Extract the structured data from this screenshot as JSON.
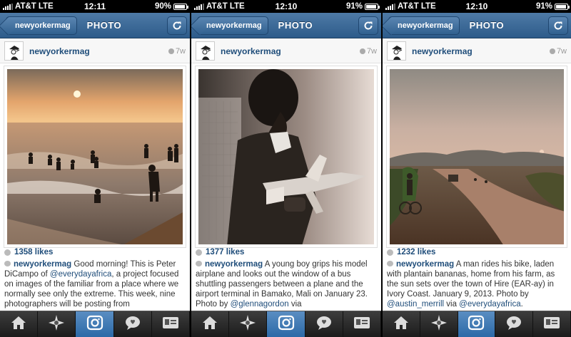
{
  "screens": [
    {
      "status": {
        "carrier": "AT&T",
        "network": "LTE",
        "time": "12:11",
        "battery": "90%",
        "battery_level": 0.9
      },
      "nav": {
        "back_label": "newyorkermag",
        "title": "PHOTO"
      },
      "post": {
        "username": "newyorkermag",
        "age": "7w",
        "likes": "1358 likes"
      },
      "caption": {
        "user": "newyorkermag",
        "parts": [
          {
            "t": "text",
            "v": " Good morning! This is Peter DiCampo of "
          },
          {
            "t": "mention",
            "v": "@everydayafrica"
          },
          {
            "t": "text",
            "v": ", a project focused on images of the familiar from a place where we normally see only the extreme. This week, nine photographers will be posting from"
          }
        ]
      }
    },
    {
      "status": {
        "carrier": "AT&T",
        "network": "LTE",
        "time": "12:10",
        "battery": "91%",
        "battery_level": 0.91
      },
      "nav": {
        "back_label": "newyorkermag",
        "title": "PHOTO"
      },
      "post": {
        "username": "newyorkermag",
        "age": "7w",
        "likes": "1377 likes"
      },
      "caption": {
        "user": "newyorkermag",
        "parts": [
          {
            "t": "text",
            "v": " A young boy grips his model airplane and looks out the window of a bus shuttling passengers between a plane and the airport terminal in Bamako, Mali on January 23. Photo by "
          },
          {
            "t": "mention",
            "v": "@glennagordon"
          },
          {
            "t": "text",
            "v": " via"
          }
        ]
      }
    },
    {
      "status": {
        "carrier": "AT&T",
        "network": "LTE",
        "time": "12:10",
        "battery": "91%",
        "battery_level": 0.91
      },
      "nav": {
        "back_label": "newyorkermag",
        "title": "PHOTO"
      },
      "post": {
        "username": "newyorkermag",
        "age": "7w",
        "likes": "1232 likes"
      },
      "caption": {
        "user": "newyorkermag",
        "parts": [
          {
            "t": "text",
            "v": " A man rides his bike, laden with plantain bananas, home from his farm, as the sun sets over the town of Hire (EAR-ay) in Ivory Coast. January 9, 2013. Photo by "
          },
          {
            "t": "mention",
            "v": "@austin_merrill"
          },
          {
            "t": "text",
            "v": " via "
          },
          {
            "t": "mention",
            "v": "@everydayafrica"
          },
          {
            "t": "text",
            "v": "."
          }
        ]
      }
    }
  ],
  "tabs": [
    {
      "icon": "home-icon"
    },
    {
      "icon": "explore-star-icon"
    },
    {
      "icon": "camera-icon"
    },
    {
      "icon": "activity-bubble-icon"
    },
    {
      "icon": "profile-card-icon"
    }
  ],
  "active_tab": 2,
  "colors": {
    "nav_blue": "#2d5b8a",
    "link_blue": "#1f4d7a",
    "tab_active": "#3b7bbd"
  }
}
